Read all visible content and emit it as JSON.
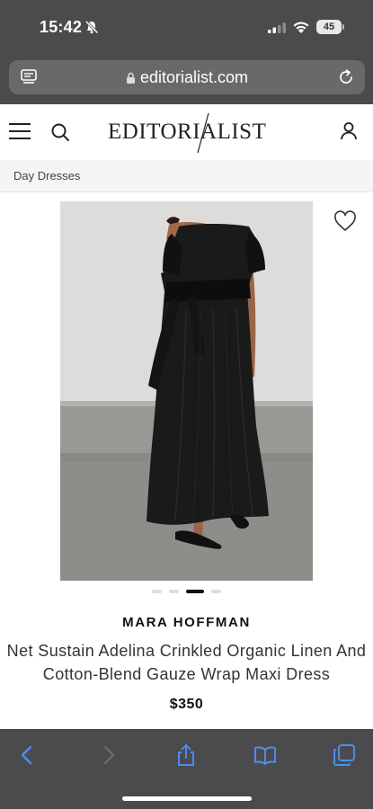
{
  "status_bar": {
    "time": "15:42",
    "battery": "45",
    "icons": [
      "bell-slash-icon",
      "signal-icon",
      "wifi-icon",
      "battery-icon"
    ]
  },
  "browser": {
    "url": "editorialist.com",
    "icons": [
      "reader-mode-icon",
      "lock-icon",
      "reload-icon"
    ]
  },
  "site": {
    "logo_left": "EDITORI",
    "logo_right": "ALIST",
    "icons": [
      "menu-icon",
      "search-icon",
      "account-icon"
    ]
  },
  "breadcrumb": {
    "label": "Day Dresses"
  },
  "product": {
    "brand": "MARA HOFFMAN",
    "name": "Net Sustain Adelina Crinkled Organic Linen And Cotton-Blend Gauze Wrap Maxi Dress",
    "price": "$350",
    "image_count": 4,
    "active_image": 3,
    "wishlist_icon": "heart-outline-icon"
  },
  "toolbar": {
    "icons": [
      "back-icon",
      "forward-icon",
      "share-icon",
      "bookmarks-icon",
      "tabs-icon"
    ],
    "accent": "#4a90f0"
  },
  "colors": {
    "browser_chrome": "#4b4b4d",
    "page_bg": "#ffffff",
    "breadcrumb_bg": "#f5f5f5",
    "dress": "#1a1a1a"
  }
}
